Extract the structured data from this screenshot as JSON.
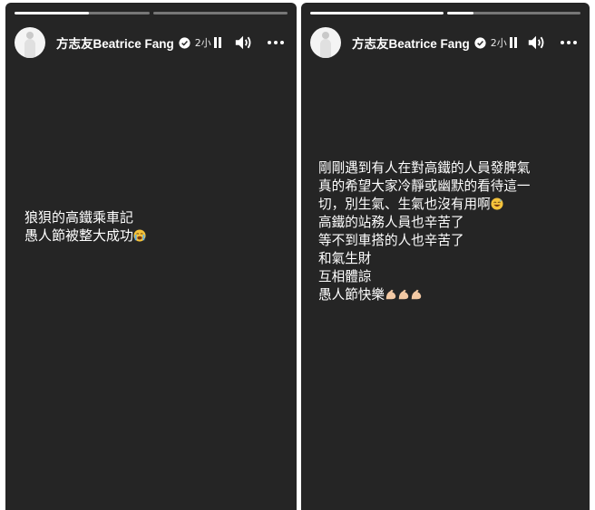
{
  "stories": [
    {
      "author": "方志友Beatrice Fang",
      "time": "2小",
      "progress": [
        0.55,
        0.0
      ],
      "text_lines": [
        {
          "text": "狼狽的高鐵乘車記",
          "emoji": null
        },
        {
          "text": "愚人節被整大成功",
          "emoji": "crying-face"
        }
      ]
    },
    {
      "author": "方志友Beatrice Fang",
      "time": "2小",
      "progress": [
        1.0,
        0.2
      ],
      "text_lines": [
        {
          "text": "剛剛遇到有人在對高鐵的人員發脾氣",
          "emoji": null
        },
        {
          "text": "真的希望大家冷靜或幽默的看待這一",
          "emoji": null
        },
        {
          "text": "切，別生氣、生氣也沒有用啊",
          "emoji": "grinning-sweat-face"
        },
        {
          "text": "高鐵的站務人員也辛苦了",
          "emoji": null
        },
        {
          "text": "等不到車搭的人也辛苦了",
          "emoji": null
        },
        {
          "text": "和氣生財",
          "emoji": null
        },
        {
          "text": "互相體諒",
          "emoji": null
        },
        {
          "text": "愚人節快樂",
          "emoji": "flexed-biceps-x3"
        }
      ]
    }
  ],
  "colors": {
    "story_bg": "#252525",
    "text": "#ffffff",
    "progress_track": "#6a6a6a",
    "verified_badge": "#ffffff",
    "emoji_yellow": "#f5c33b",
    "emoji_skin": "#f3c9a4"
  },
  "icons": [
    "verified-badge-icon",
    "pause-icon",
    "sound-icon",
    "more-options-icon"
  ]
}
